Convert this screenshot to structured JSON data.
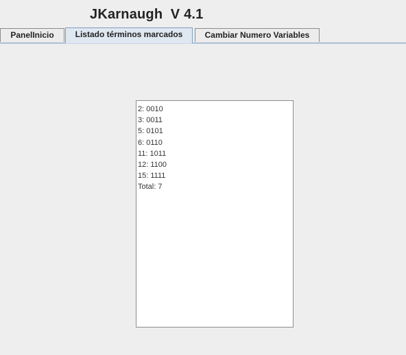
{
  "window": {
    "title": "JKarnaugh  V 4.1"
  },
  "tabs": [
    {
      "label": "PanelInicio",
      "selected": false
    },
    {
      "label": "Listado términos marcados",
      "selected": true
    },
    {
      "label": "Cambiar Numero Variables",
      "selected": false
    }
  ],
  "terms_list": {
    "lines": [
      "2: 0010",
      "3: 0011",
      "5: 0101",
      "6: 0110",
      "11: 1011",
      "12: 1100",
      "15: 1111",
      "Total: 7"
    ]
  },
  "colors": {
    "background": "#eeeeee",
    "active_tab": "#dfe7f1",
    "tab_accent": "#8fa8c8"
  }
}
